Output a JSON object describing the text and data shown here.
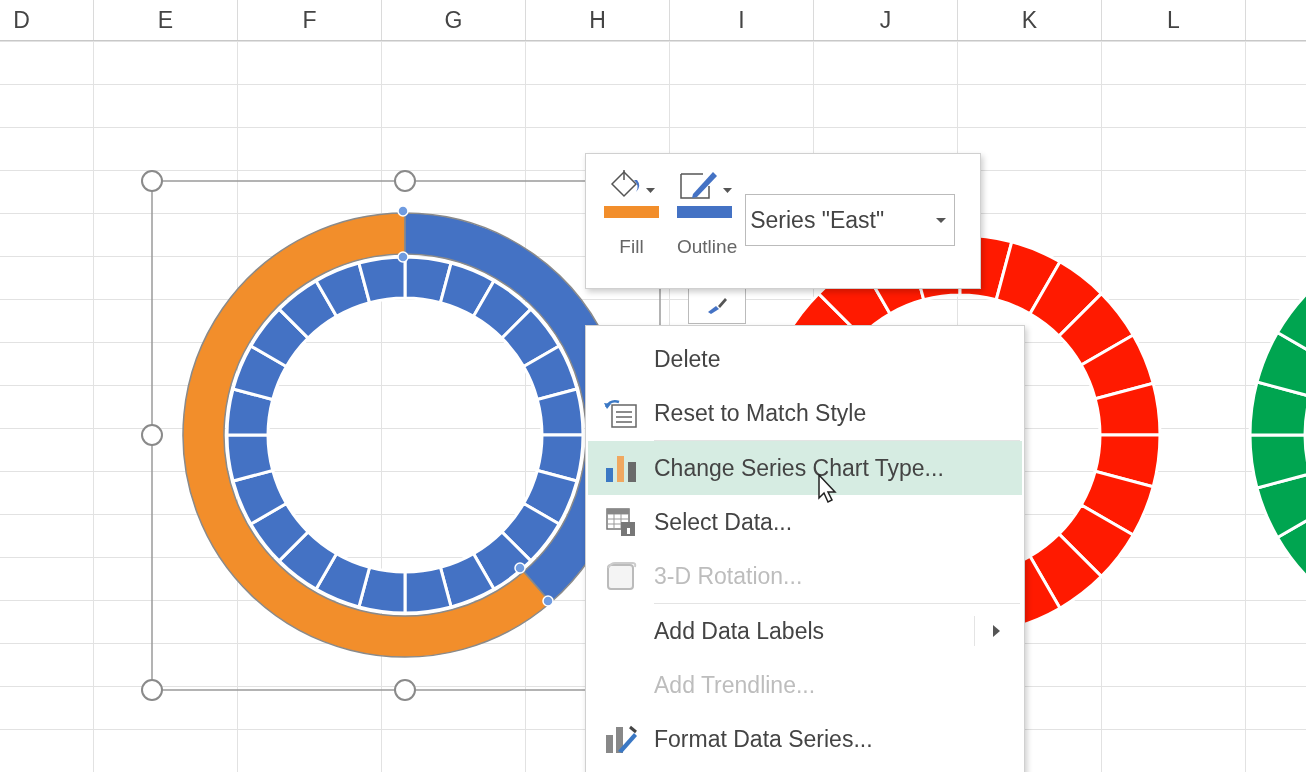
{
  "column_headers": [
    "D",
    "E",
    "F",
    "G",
    "H",
    "I",
    "J",
    "K",
    "L"
  ],
  "mini_toolbar": {
    "fill": {
      "label": "Fill",
      "color": "#f28e2b"
    },
    "outline": {
      "label": "Outline",
      "color": "#4472c4"
    },
    "series_dropdown": {
      "value": "Series \"East\""
    }
  },
  "context_menu": {
    "items": [
      {
        "label": "Delete",
        "kind": "plain",
        "disabled": false,
        "selected": false,
        "submenu": false,
        "separator_after": false
      },
      {
        "label": "Reset to Match Style",
        "kind": "reset",
        "disabled": false,
        "selected": false,
        "submenu": false,
        "separator_after": true
      },
      {
        "label": "Change Series Chart Type...",
        "kind": "charttype",
        "disabled": false,
        "selected": true,
        "submenu": false,
        "separator_after": false
      },
      {
        "label": "Select Data...",
        "kind": "selectdata",
        "disabled": false,
        "selected": false,
        "submenu": false,
        "separator_after": false
      },
      {
        "label": "3-D Rotation...",
        "kind": "rotation",
        "disabled": true,
        "selected": false,
        "submenu": false,
        "separator_after": true
      },
      {
        "label": "Add Data Labels",
        "kind": "plain",
        "disabled": false,
        "selected": false,
        "submenu": true,
        "separator_after": false
      },
      {
        "label": "Add Trendline...",
        "kind": "plain",
        "disabled": true,
        "selected": false,
        "submenu": false,
        "separator_after": false
      },
      {
        "label": "Format Data Series...",
        "kind": "format",
        "disabled": false,
        "selected": false,
        "submenu": false,
        "separator_after": false
      }
    ]
  }
}
